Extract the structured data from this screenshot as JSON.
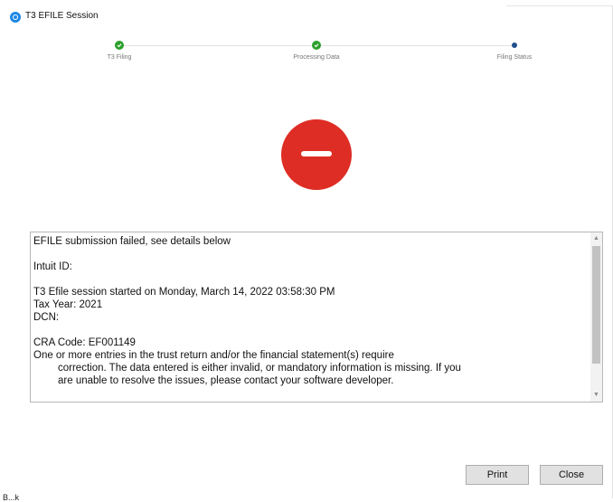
{
  "window": {
    "title": "T3 EFILE Session",
    "app_icon": "efile-app-icon"
  },
  "stepper": {
    "steps": [
      {
        "label": "T3 Filing",
        "state": "complete",
        "icon": "check-icon"
      },
      {
        "label": "Processing Data",
        "state": "complete",
        "icon": "check-icon"
      },
      {
        "label": "Filing Status",
        "state": "current",
        "icon": "dot-icon"
      }
    ],
    "complete_color": "#2ca02c",
    "current_color": "#1f4e8c"
  },
  "status": {
    "icon": "error-minus-icon",
    "color": "#de2d24"
  },
  "details": {
    "lines": [
      "EFILE submission failed, see details below",
      "",
      "Intuit ID:",
      "",
      "T3 Efile session started on Monday, March 14, 2022 03:58:30 PM",
      "Tax Year: 2021",
      "DCN:",
      "",
      "CRA Code: EF001149",
      "One or more entries in the trust return and/or the financial statement(s) require",
      "correction. The data entered is either invalid, or mandatory information is missing. If you",
      "are unable to resolve the issues, please contact your software developer."
    ]
  },
  "buttons": {
    "print_label": "Print",
    "close_label": "Close"
  },
  "footer": {
    "partial_text": "B...k"
  }
}
